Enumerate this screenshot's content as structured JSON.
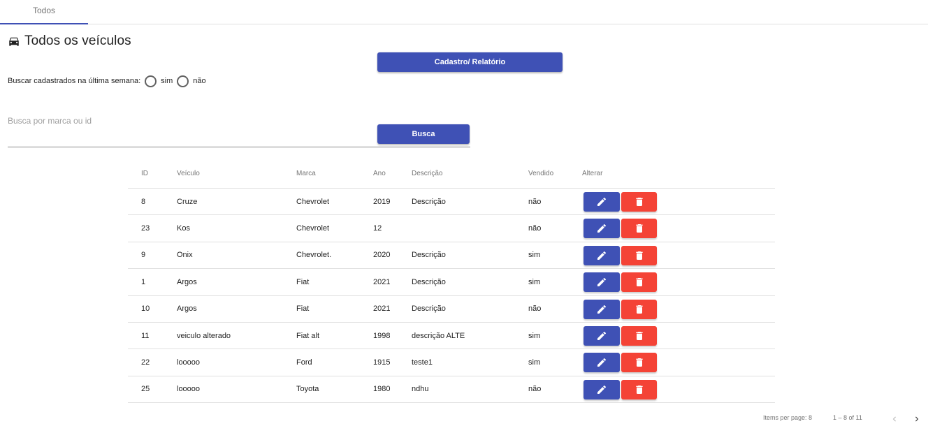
{
  "tabs": [
    {
      "label": "Todos",
      "active": true
    }
  ],
  "page": {
    "title": "Todos os veículos",
    "icon": "car-icon"
  },
  "buttons": {
    "cadastro": "Cadastro/ Relatório",
    "busca": "Busca"
  },
  "filter": {
    "label": "Buscar cadastrados na última semana:",
    "options": [
      "sim",
      "não"
    ]
  },
  "search": {
    "placeholder": "Busca por marca ou id",
    "value": ""
  },
  "table": {
    "headers": {
      "id": "ID",
      "veiculo": "Veículo",
      "marca": "Marca",
      "ano": "Ano",
      "descricao": "Descrição",
      "vendido": "Vendido",
      "alterar": "Alterar"
    },
    "rows": [
      {
        "id": "8",
        "veiculo": "Cruze",
        "marca": "Chevrolet",
        "ano": "2019",
        "descricao": "Descrição",
        "vendido": "não"
      },
      {
        "id": "23",
        "veiculo": "Kos",
        "marca": "Chevrolet",
        "ano": "12",
        "descricao": "",
        "vendido": "não"
      },
      {
        "id": "9",
        "veiculo": "Onix",
        "marca": "Chevrolet.",
        "ano": "2020",
        "descricao": "Descrição",
        "vendido": "sim"
      },
      {
        "id": "1",
        "veiculo": "Argos",
        "marca": "Fiat",
        "ano": "2021",
        "descricao": "Descrição",
        "vendido": "sim"
      },
      {
        "id": "10",
        "veiculo": "Argos",
        "marca": "Fiat",
        "ano": "2021",
        "descricao": "Descrição",
        "vendido": "não"
      },
      {
        "id": "11",
        "veiculo": "veiculo alterado",
        "marca": "Fiat alt",
        "ano": "1998",
        "descricao": "descrição ALTE",
        "vendido": "sim"
      },
      {
        "id": "22",
        "veiculo": "looooo",
        "marca": "Ford",
        "ano": "1915",
        "descricao": "teste1",
        "vendido": "sim"
      },
      {
        "id": "25",
        "veiculo": "looooo",
        "marca": "Toyota",
        "ano": "1980",
        "descricao": "ndhu",
        "vendido": "não"
      }
    ]
  },
  "paginator": {
    "items_per_page_label": "Items per page: 8",
    "range_label": "1 – 8 of 11"
  },
  "colors": {
    "primary": "#3f51b5",
    "warn": "#f44336"
  }
}
